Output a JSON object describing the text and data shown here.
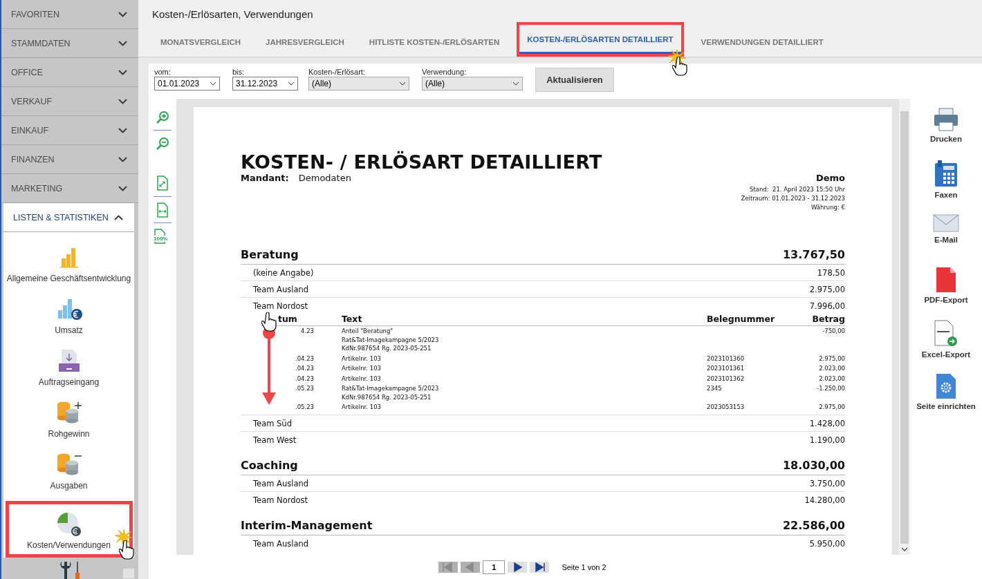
{
  "sidebar": {
    "sections": [
      {
        "label": "FAVORITEN",
        "expanded": false
      },
      {
        "label": "STAMMDATEN",
        "expanded": false
      },
      {
        "label": "OFFICE",
        "expanded": false
      },
      {
        "label": "VERKAUF",
        "expanded": false
      },
      {
        "label": "EINKAUF",
        "expanded": false
      },
      {
        "label": "FINANZEN",
        "expanded": false
      },
      {
        "label": "MARKETING",
        "expanded": false
      },
      {
        "label": "LISTEN & STATISTIKEN",
        "expanded": true
      }
    ],
    "items": [
      {
        "label": "Allgemeine Geschäftsentwicklung",
        "kind": "bars",
        "selected": false
      },
      {
        "label": "Umsatz",
        "kind": "revenue",
        "selected": false
      },
      {
        "label": "Auftragseingang",
        "kind": "inbox",
        "selected": false
      },
      {
        "label": "Rohgewinn",
        "kind": "coins_plus",
        "selected": false
      },
      {
        "label": "Ausgaben",
        "kind": "coins_minus",
        "selected": false
      },
      {
        "label": "Kosten/Verwendungen",
        "kind": "pie",
        "selected": true
      }
    ]
  },
  "title": "Kosten-/Erlösarten, Verwendungen",
  "tabs": [
    {
      "label": "MONATSVERGLEICH",
      "selected": false
    },
    {
      "label": "JAHRESVERGLEICH",
      "selected": false
    },
    {
      "label": "HITLISTE KOSTEN-/ERLÖSARTEN",
      "selected": false
    },
    {
      "label": "KOSTEN-/ERLÖSARTEN DETAILLIERT",
      "selected": true
    },
    {
      "label": "VERWENDUNGEN DETAILLIERT",
      "selected": false
    }
  ],
  "filters": [
    {
      "label": "vom:",
      "value": "01.01.2023",
      "kind": "date"
    },
    {
      "label": "bis:",
      "value": "31.12.2023",
      "kind": "date"
    },
    {
      "label": "Kosten-/Erlösart:",
      "value": "(Alle)",
      "kind": "select"
    },
    {
      "label": "Verwendung:",
      "value": "(Alle)",
      "kind": "select"
    }
  ],
  "refresh_button": "Aktualisieren",
  "tools": [
    {
      "kind": "zoom_in"
    },
    {
      "kind": "zoom_out"
    },
    {
      "kind": "fit_page"
    },
    {
      "kind": "fit_width"
    },
    {
      "kind": "actual_size",
      "label": "100%"
    }
  ],
  "report": {
    "title": "KOSTEN- / ERLÖSART DETAILLIERT",
    "mandant_label": "Mandant:",
    "mandant": "Demodaten",
    "company": "Demo",
    "meta": [
      "Stand:  21. April 2023 15:50 Uhr",
      "Zeitraum: 01.01.2023 - 31.12.2023",
      "Währung: €"
    ],
    "groups": [
      {
        "name": "Beratung",
        "total": "13.767,50",
        "rows": [
          {
            "name": "(keine Angabe)",
            "amount": "178,50"
          },
          {
            "name": "Team Ausland",
            "amount": "2.975,00"
          },
          {
            "name": "Team Nordost",
            "amount": "7.996,00",
            "details": {
              "columns": [
                "tum",
                "Text",
                "Belegnummer",
                "Betrag"
              ],
              "entries": [
                {
                  "date": "4.23",
                  "text": [
                    "Anteil \"Beratung\"",
                    "Rat&Tat-Imagekampagne 5/2023",
                    "KdNr.987654 Rg. 2023-05-251"
                  ],
                  "amount": "-750,00"
                },
                {
                  "date": ".04.23",
                  "text": [
                    "Artikelnr. 103"
                  ],
                  "number": "2023101360",
                  "amount": "2.975,00"
                },
                {
                  "date": ".04.23",
                  "text": [
                    "Artikelnr. 103"
                  ],
                  "number": "2023101361",
                  "amount": "2.023,00"
                },
                {
                  "date": ".04.23",
                  "text": [
                    "Artikelnr. 103"
                  ],
                  "number": "2023101362",
                  "amount": "2.023,00"
                },
                {
                  "date": ".05.23",
                  "text": [
                    "Rat&Tat-Imagekampagne 5/2023",
                    "KdNr.987654 Rg. 2023-05-251"
                  ],
                  "number": "2345",
                  "amount": "-1.250,00"
                },
                {
                  "date": ".05.23",
                  "text": [
                    "Artikelnr. 103"
                  ],
                  "number": "2023053153",
                  "amount": "2.975,00"
                }
              ]
            }
          },
          {
            "name": "Team Süd",
            "amount": "1.428,00"
          },
          {
            "name": "Team West",
            "amount": "1.190,00"
          }
        ]
      },
      {
        "name": "Coaching",
        "total": "18.030,00",
        "rows": [
          {
            "name": "Team Ausland",
            "amount": "3.750,00"
          },
          {
            "name": "Team Nordost",
            "amount": "14.280,00"
          }
        ]
      },
      {
        "name": "Interim-Management",
        "total": "22.586,00",
        "rows": [
          {
            "name": "Team Ausland",
            "amount": "5.950,00"
          }
        ]
      }
    ]
  },
  "actions": [
    {
      "label": "Drucken",
      "kind": "print"
    },
    {
      "label": "Faxen",
      "kind": "fax"
    },
    {
      "label": "E-Mail",
      "kind": "mail"
    },
    {
      "label": "PDF-Export",
      "kind": "pdf"
    },
    {
      "label": "Excel-Export",
      "kind": "excel"
    },
    {
      "label": "Seite einrichten",
      "kind": "setup"
    }
  ],
  "pager": {
    "buttons": [
      {
        "kind": "first",
        "disabled": true
      },
      {
        "kind": "prev",
        "disabled": true
      },
      {
        "kind": "next",
        "disabled": false
      },
      {
        "kind": "last",
        "disabled": false
      }
    ],
    "page": "1",
    "info": "Seite 1 von 2"
  }
}
